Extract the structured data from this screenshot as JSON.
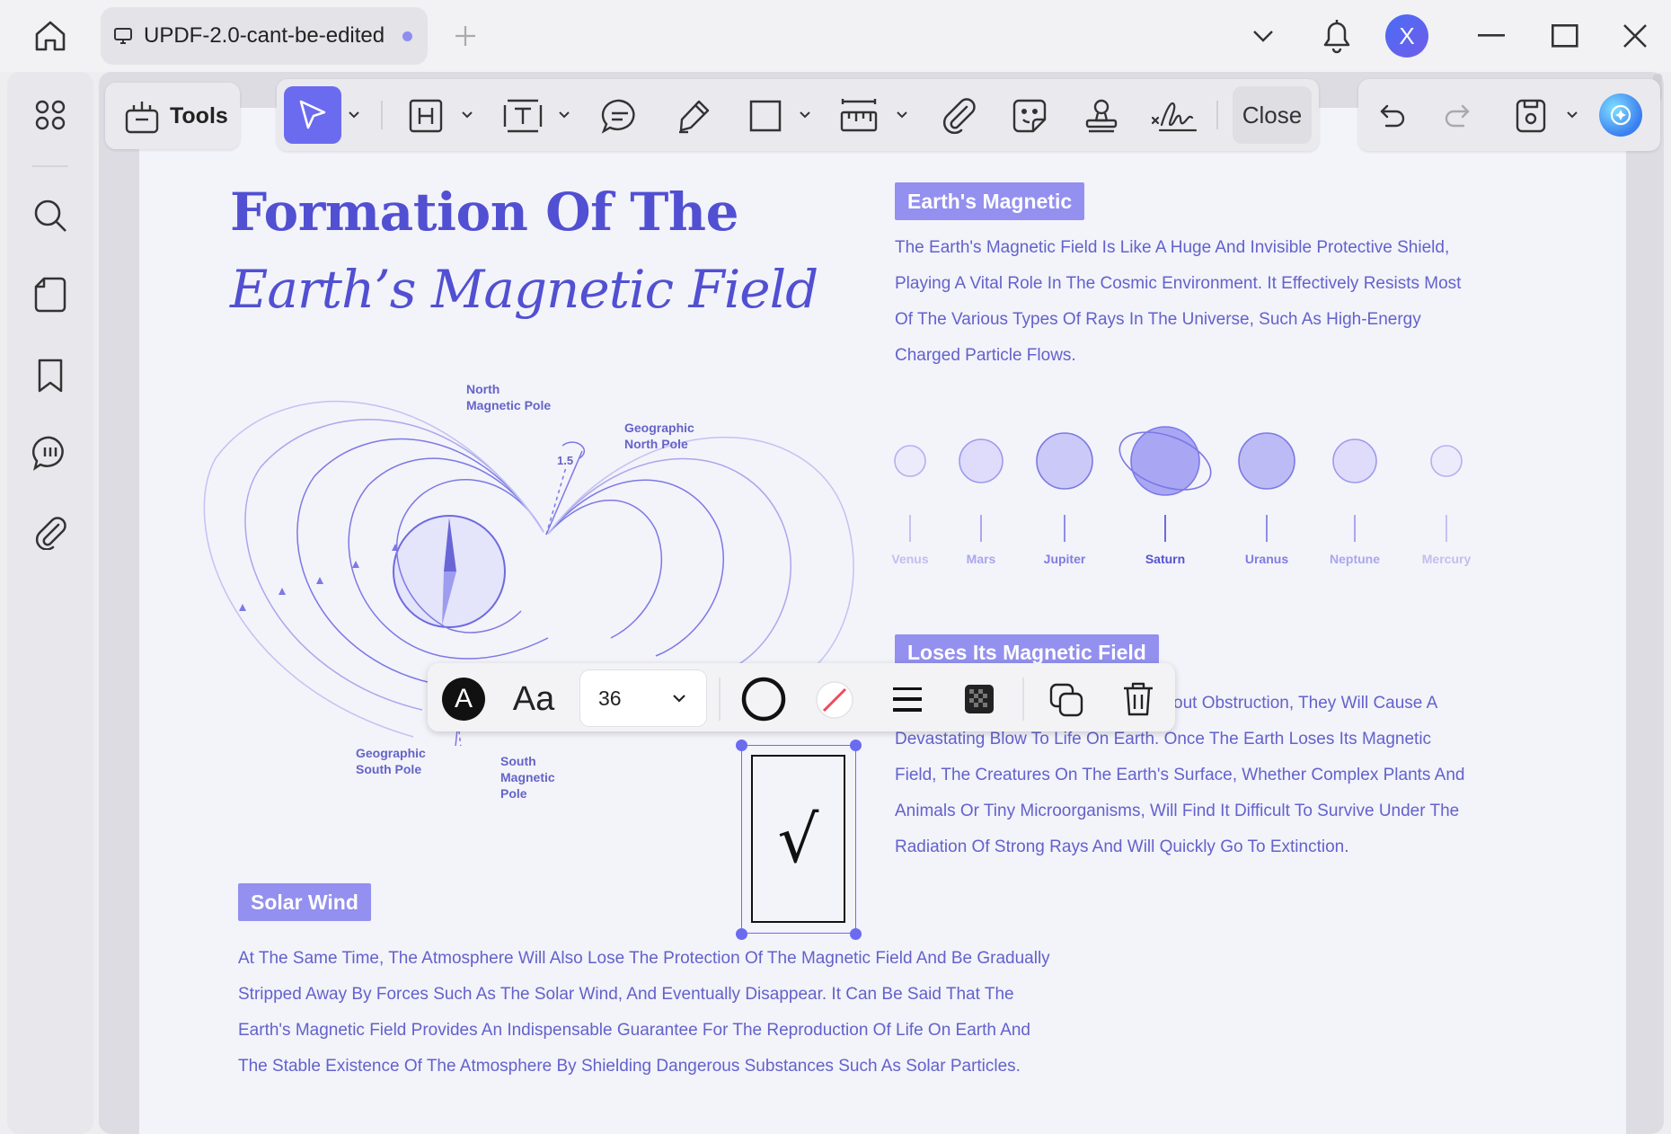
{
  "app": {
    "tab_title": "UPDF-2.0-cant-be-edited",
    "avatar_letter": "X",
    "accent": "#6b6bf0"
  },
  "toolbar": {
    "tools_label": "Tools",
    "close_label": "Close"
  },
  "float_toolbar": {
    "font_glyph": "A",
    "font_family_glyph": "Aa",
    "font_size": "36"
  },
  "doc": {
    "title_line1": "Formation Of The",
    "title_line2": "Earth’s Magnetic Field",
    "diagram": {
      "north_magnetic": [
        "North",
        "Magnetic Pole"
      ],
      "geo_north": [
        "Geographic",
        "North Pole"
      ],
      "angle": "1.5",
      "geo_south": [
        "Geographic",
        "South Pole"
      ],
      "south_magnetic": [
        "South",
        "Magnetic",
        "Pole"
      ]
    },
    "earth_magnetic": {
      "heading": "Earth's Magnetic",
      "lines": [
        "The Earth's Magnetic Field Is Like A Huge And Invisible Protective Shield,",
        "Playing A Vital Role In The Cosmic Environment. It Effectively Resists Most",
        "Of The Various Types Of Rays In The Universe, Such As High-Energy",
        "Charged Particle Flows."
      ]
    },
    "planets": [
      "Venus",
      "Mars",
      "Jupiter",
      "Saturn",
      "Uranus",
      "Neptune",
      "Mercury"
    ],
    "loses": {
      "heading": "Loses Its Magnetic Field",
      "lines": [
        "out Obstruction, They Will Cause A",
        "Devastating Blow To Life On Earth. Once The Earth Loses Its Magnetic",
        "Field, The Creatures On The Earth's Surface, Whether Complex Plants And",
        "Animals Or Tiny Microorganisms, Will Find It Difficult To Survive Under The",
        "Radiation Of Strong Rays And Will Quickly Go To Extinction."
      ]
    },
    "checkbox_glyph": "√",
    "solar": {
      "heading": "Solar Wind",
      "lines": [
        "At The Same Time, The Atmosphere Will Also Lose The Protection Of The Magnetic Field And Be Gradually",
        "Stripped Away By Forces Such As The Solar Wind, And Eventually Disappear. It Can Be Said That The",
        "Earth's Magnetic Field Provides An Indispensable Guarantee For The Reproduction Of Life On Earth And",
        "The Stable Existence Of The Atmosphere By Shielding Dangerous Substances Such As Solar Particles."
      ]
    }
  }
}
